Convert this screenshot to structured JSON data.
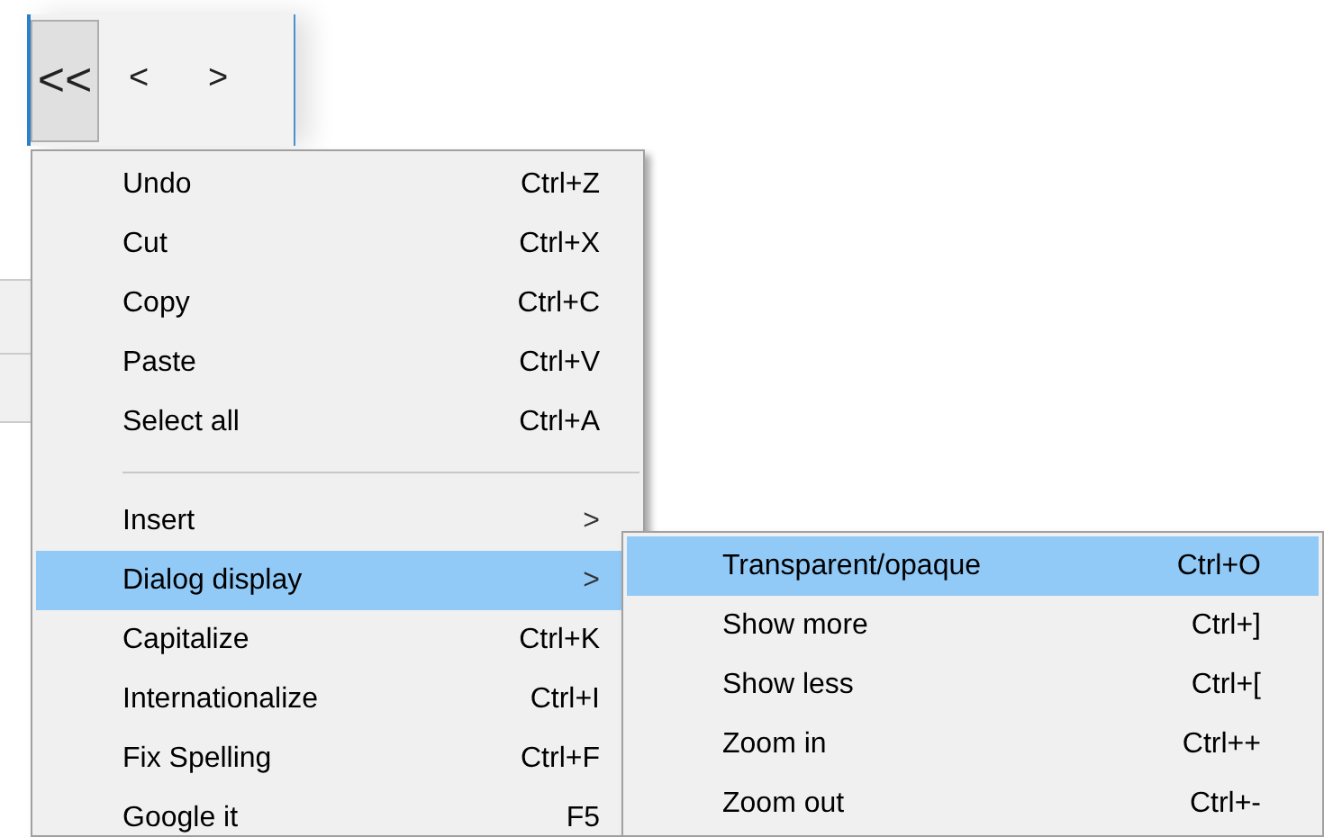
{
  "toolbar": {
    "buttons": [
      {
        "label": "<<",
        "pressed": true
      },
      {
        "label": "<",
        "pressed": false
      },
      {
        "label": ">",
        "pressed": false
      }
    ]
  },
  "context_menu": {
    "items": [
      {
        "kind": "item",
        "label": "Undo",
        "shortcut": "Ctrl+Z",
        "selected": false
      },
      {
        "kind": "item",
        "label": "Cut",
        "shortcut": "Ctrl+X",
        "selected": false
      },
      {
        "kind": "item",
        "label": "Copy",
        "shortcut": "Ctrl+C",
        "selected": false
      },
      {
        "kind": "item",
        "label": "Paste",
        "shortcut": "Ctrl+V",
        "selected": false
      },
      {
        "kind": "item",
        "label": "Select all",
        "shortcut": "Ctrl+A",
        "selected": false
      },
      {
        "kind": "separator"
      },
      {
        "kind": "submenu",
        "label": "Insert",
        "arrow": ">",
        "selected": false
      },
      {
        "kind": "submenu",
        "label": "Dialog display",
        "arrow": ">",
        "selected": true
      },
      {
        "kind": "item",
        "label": "Capitalize",
        "shortcut": "Ctrl+K",
        "selected": false
      },
      {
        "kind": "item",
        "label": "Internationalize",
        "shortcut": "Ctrl+I",
        "selected": false
      },
      {
        "kind": "item",
        "label": "Fix Spelling",
        "shortcut": "Ctrl+F",
        "selected": false
      },
      {
        "kind": "item",
        "label": "Google it",
        "shortcut": "F5",
        "selected": false
      }
    ]
  },
  "submenu": {
    "items": [
      {
        "kind": "item",
        "label": "Transparent/opaque",
        "shortcut": "Ctrl+O",
        "selected": true
      },
      {
        "kind": "item",
        "label": "Show more",
        "shortcut": "Ctrl+]",
        "selected": false
      },
      {
        "kind": "item",
        "label": "Show less",
        "shortcut": "Ctrl+[",
        "selected": false
      },
      {
        "kind": "item",
        "label": "Zoom in",
        "shortcut": "Ctrl++",
        "selected": false
      },
      {
        "kind": "item",
        "label": "Zoom out",
        "shortcut": "Ctrl+-",
        "selected": false
      }
    ]
  }
}
